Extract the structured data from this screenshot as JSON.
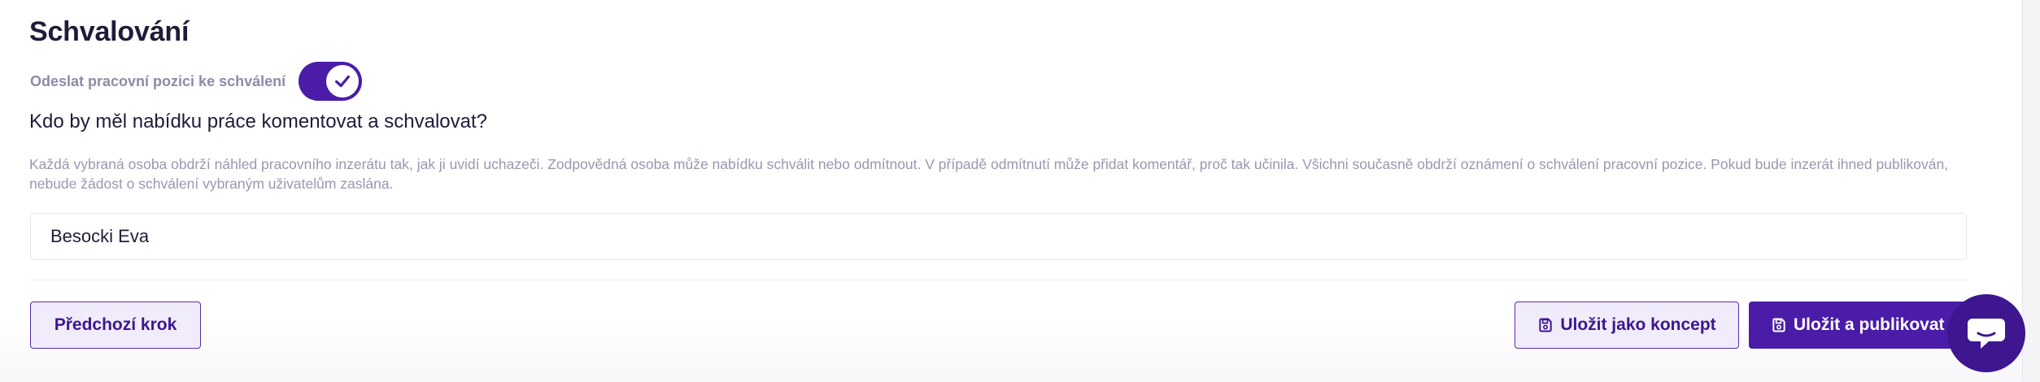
{
  "section": {
    "title": "Schvalování"
  },
  "toggle": {
    "label": "Odeslat pracovní pozici ke schválení",
    "checked": true,
    "accent_color": "#4a1ca8"
  },
  "approval": {
    "question": "Kdo by měl nabídku práce komentovat a schvalovat?",
    "help_text": "Každá vybraná osoba obdrží náhled pracovního inzerátu tak, jak ji uvidí uchazeči. Zodpovědná osoba může nabídku schválit nebo odmítnout. V případě odmítnutí může přidat komentář, proč tak učinila. Všichni současně obdrží oznámení o schválení pracovní pozice. Pokud bude inzerát ihned publikován, nebude žádost o schválení vybraným uživatelům zaslána.",
    "selected_approver": "Besocki Eva"
  },
  "footer": {
    "prev_label": "Předchozí krok",
    "draft_label": "Uložit jako koncept",
    "publish_label": "Uložit a publikovat",
    "draft_icon": "save-icon",
    "publish_icon": "save-icon"
  },
  "chat": {
    "icon": "chat-icon"
  }
}
